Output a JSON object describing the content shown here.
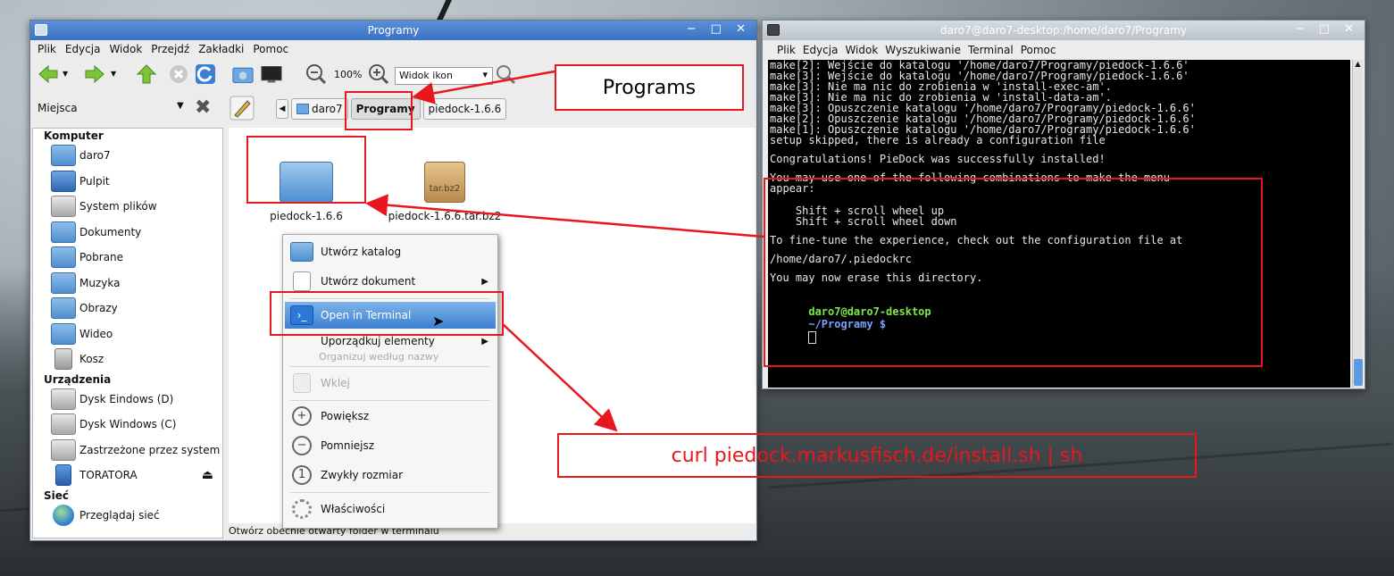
{
  "file_manager": {
    "title": "Programy",
    "menu": [
      "Plik",
      "Edycja",
      "Widok",
      "Przejdź",
      "Zakładki",
      "Pomoc"
    ],
    "zoom_level": "100%",
    "view_mode": "Widok ikon",
    "places_label": "Miejsca",
    "breadcrumbs": [
      "daro7",
      "Programy",
      "piedock-1.6.6"
    ],
    "sidebar": {
      "computer_header": "Komputer",
      "computer_items": [
        "daro7",
        "Pulpit",
        "System plików",
        "Dokumenty",
        "Pobrane",
        "Muzyka",
        "Obrazy",
        "Wideo",
        "Kosz"
      ],
      "devices_header": "Urządzenia",
      "device_items": [
        "Dysk Eindows (D)",
        "Dysk Windows (C)",
        "Zastrzeżone przez system",
        "TORATORA"
      ],
      "network_header": "Sieć",
      "network_items": [
        "Przeglądaj sieć"
      ]
    },
    "files": [
      {
        "name": "piedock-1.6.6",
        "type": "folder"
      },
      {
        "name": "piedock-1.6.6.tar.bz2",
        "type": "archive",
        "badge": "tar.bz2"
      }
    ],
    "status": "Otwórz obecnie otwarty folder w terminalu",
    "context_menu": {
      "items": [
        "Utwórz katalog",
        "Utwórz dokument",
        "Open in Terminal",
        "Uporządkuj elementy",
        "Wklej",
        "Powiększ",
        "Pomniejsz",
        "Zwykły rozmiar",
        "Właściwości"
      ],
      "sort_hint": "Organizuj według nazwy"
    }
  },
  "terminal": {
    "title": "daro7@daro7-desktop:/home/daro7/Programy",
    "menu": [
      "Plik",
      "Edycja",
      "Widok",
      "Wyszukiwanie",
      "Terminal",
      "Pomoc"
    ],
    "lines": [
      "make[2]: Wejście do katalogu '/home/daro7/Programy/piedock-1.6.6'",
      "make[3]: Wejście do katalogu '/home/daro7/Programy/piedock-1.6.6'",
      "make[3]: Nie ma nic do zrobienia w 'install-exec-am'.",
      "make[3]: Nie ma nic do zrobienia w 'install-data-am'.",
      "make[3]: Opuszczenie katalogu '/home/daro7/Programy/piedock-1.6.6'",
      "make[2]: Opuszczenie katalogu '/home/daro7/Programy/piedock-1.6.6'",
      "make[1]: Opuszczenie katalogu '/home/daro7/Programy/piedock-1.6.6'",
      "setup skipped, there is already a configuration file"
    ],
    "message": [
      "Congratulations! PieDock was successfully installed!",
      "You may use one of the following combinations to make the menu",
      "appear:",
      "    Shift + scroll wheel up",
      "    Shift + scroll wheel down",
      "To fine-tune the experience, check out the configuration file at",
      "/home/daro7/.piedockrc",
      "You may now erase this directory."
    ],
    "prompt_user": "daro7@daro7-desktop",
    "prompt_path": "~/Programy $"
  },
  "annotations": {
    "programs_label": "Programs",
    "curl_command": "curl piedock.markusfisch.de/install.sh | sh",
    "color": "#e8171e"
  }
}
